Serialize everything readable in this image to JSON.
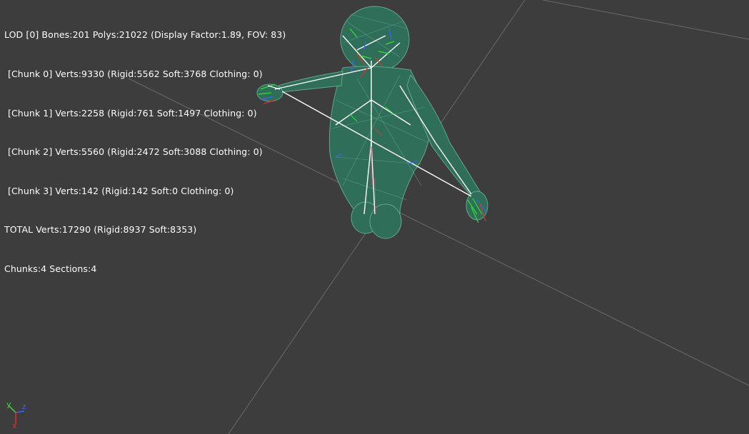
{
  "overlay": {
    "lod_line": "LOD [0] Bones:201 Polys:21022 (Display Factor:1.89, FOV: 83)",
    "chunks": [
      "[Chunk 0] Verts:9330 (Rigid:5562 Soft:3768 Clothing: 0)",
      "[Chunk 1] Verts:2258 (Rigid:761 Soft:1497 Clothing: 0)",
      "[Chunk 2] Verts:5560 (Rigid:2472 Soft:3088 Clothing: 0)",
      "[Chunk 3] Verts:142 (Rigid:142 Soft:0 Clothing: 0)"
    ],
    "total_line": "TOTAL Verts:17290 (Rigid:8937 Soft:8353)",
    "sections_line": "Chunks:4 Sections:4"
  },
  "gizmo": {
    "y_label": "y",
    "z_label": "z",
    "x_label": "x"
  },
  "colors": {
    "background": "#3d3d3d",
    "grid_line": "#6a6a6a",
    "mesh_fill": "#2f6e58",
    "mesh_wire": "#5fa88a",
    "bone": "#ffffff",
    "axis_x": "#e03030",
    "axis_y": "#30e030",
    "axis_z": "#4060ff"
  }
}
